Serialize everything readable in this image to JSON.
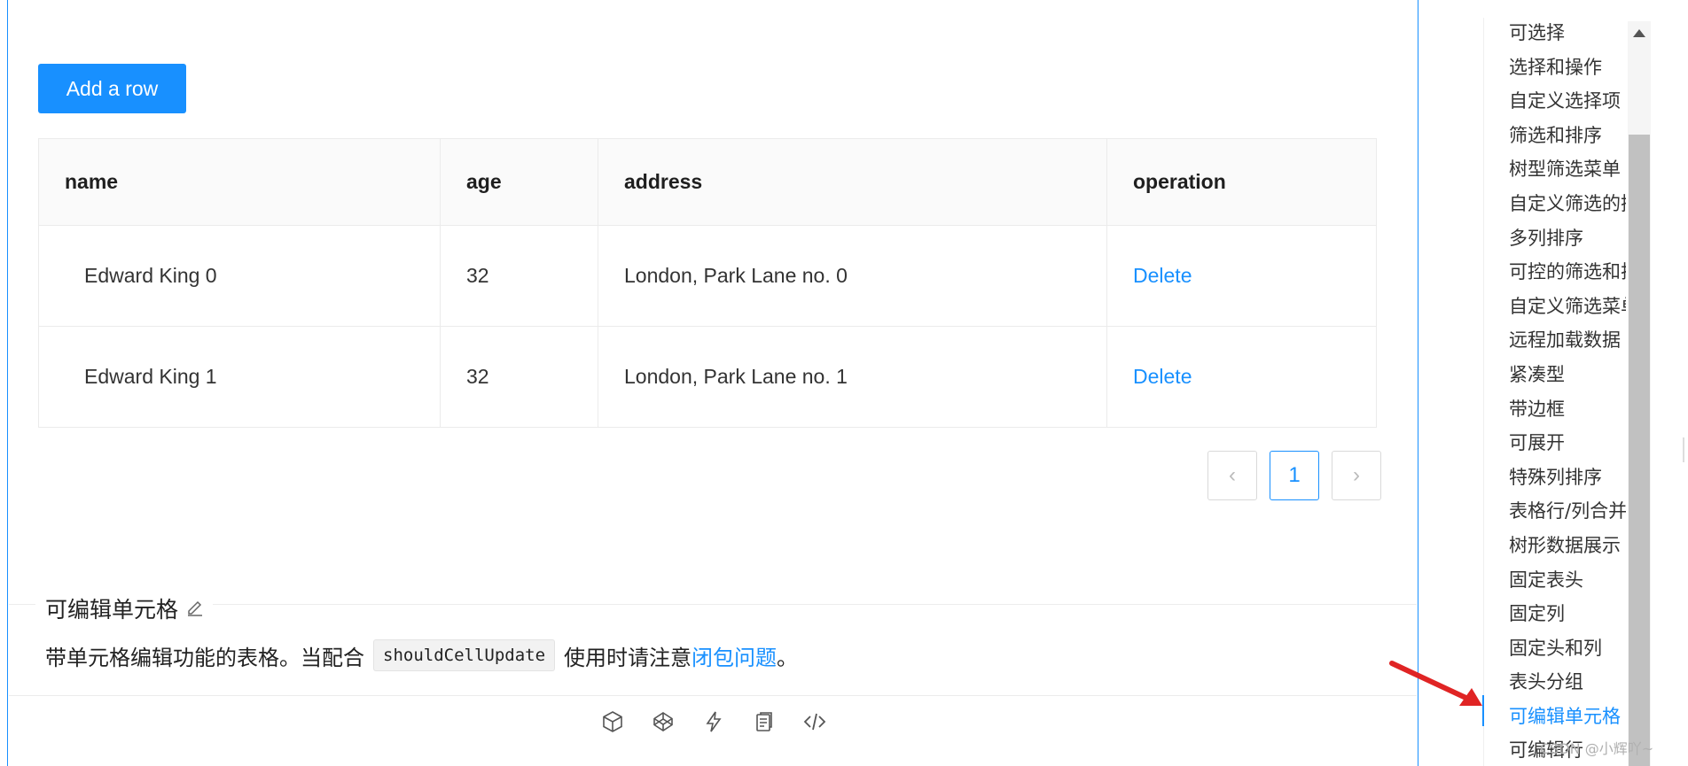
{
  "demo": {
    "add_button": "Add a row",
    "table": {
      "headers": [
        "name",
        "age",
        "address",
        "operation"
      ],
      "rows": [
        {
          "name": "Edward King 0",
          "age": "32",
          "address": "London, Park Lane no. 0",
          "operation": "Delete"
        },
        {
          "name": "Edward King 1",
          "age": "32",
          "address": "London, Park Lane no. 1",
          "operation": "Delete"
        }
      ]
    },
    "pagination": {
      "prev": "‹",
      "current": "1",
      "next": "›"
    }
  },
  "section": {
    "title": "可编辑单元格",
    "desc_before": "带单元格编辑功能的表格。当配合",
    "code": "shouldCellUpdate",
    "desc_middle": "使用时请注意",
    "desc_link": "闭包问题",
    "desc_after": "。"
  },
  "nav": {
    "items": [
      "可选择",
      "选择和操作",
      "自定义选择项",
      "筛选和排序",
      "树型筛选菜单",
      "自定义筛选的搜索",
      "多列排序",
      "可控的筛选和排序",
      "自定义筛选菜单",
      "远程加载数据",
      "紧凑型",
      "带边框",
      "可展开",
      "特殊列排序",
      "表格行/列合并",
      "树形数据展示",
      "固定表头",
      "固定列",
      "固定头和列",
      "表头分组",
      "可编辑单元格",
      "可编辑行"
    ],
    "active_index": 20
  },
  "icons": [
    "codesandbox-icon",
    "codepen-icon",
    "thunder-icon",
    "copy-icon",
    "code-icon"
  ],
  "colors": {
    "primary": "#1890ff",
    "arrow": "#e02424"
  },
  "watermark": "CSDN @小辉吖~"
}
